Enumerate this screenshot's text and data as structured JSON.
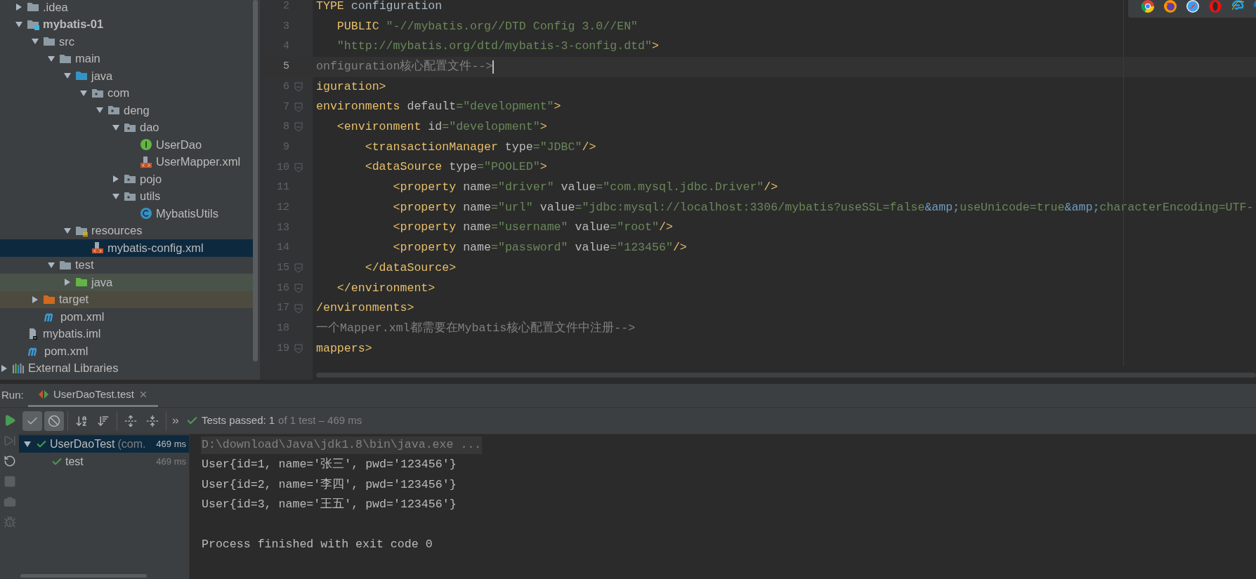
{
  "project_tree": {
    "items": [
      {
        "children": [
          {
            "label": ".idea",
            "kind": "folder",
            "expanded": false,
            "selected": false
          },
          {
            "label": "mybatis-01",
            "kind": "module",
            "expanded": true,
            "selected": false,
            "children": [
              {
                "label": "src",
                "kind": "folder",
                "expanded": true,
                "selected": false,
                "children": [
                  {
                    "label": "main",
                    "kind": "folder",
                    "expanded": true,
                    "selected": false,
                    "children": [
                      {
                        "label": "java",
                        "kind": "source-folder",
                        "expanded": true,
                        "selected": false,
                        "children": [
                          {
                            "label": "com",
                            "kind": "package",
                            "expanded": true,
                            "selected": false,
                            "children": [
                              {
                                "label": "deng",
                                "kind": "package",
                                "expanded": true,
                                "selected": false,
                                "children": [
                                  {
                                    "label": "dao",
                                    "kind": "package",
                                    "expanded": true,
                                    "selected": false,
                                    "children": [
                                      {
                                        "label": "UserDao",
                                        "kind": "interface",
                                        "selected": false
                                      },
                                      {
                                        "label": "UserMapper.xml",
                                        "kind": "xml",
                                        "selected": false
                                      }
                                    ]
                                  },
                                  {
                                    "label": "pojo",
                                    "kind": "package",
                                    "expanded": false,
                                    "selected": false
                                  },
                                  {
                                    "label": "utils",
                                    "kind": "package",
                                    "expanded": true,
                                    "selected": false,
                                    "children": [
                                      {
                                        "label": "MybatisUtils",
                                        "kind": "class",
                                        "selected": false
                                      }
                                    ]
                                  }
                                ]
                              }
                            ]
                          }
                        ]
                      },
                      {
                        "label": "resources",
                        "kind": "resources",
                        "expanded": true,
                        "selected": false,
                        "children": [
                          {
                            "label": "mybatis-config.xml",
                            "kind": "xml",
                            "selected": true
                          }
                        ]
                      }
                    ]
                  },
                  {
                    "label": "test",
                    "kind": "folder",
                    "expanded": true,
                    "selected": false,
                    "children": [
                      {
                        "label": "java",
                        "kind": "test-folder",
                        "expanded": false,
                        "selected": false
                      }
                    ]
                  }
                ]
              },
              {
                "label": "target",
                "kind": "excluded-folder",
                "expanded": false,
                "selected": false
              },
              {
                "label": "pom.xml",
                "kind": "maven",
                "selected": false
              }
            ]
          },
          {
            "label": "mybatis.iml",
            "kind": "iml",
            "selected": false
          },
          {
            "label": "pom.xml",
            "kind": "maven",
            "selected": false
          }
        ]
      },
      {
        "label": "External Libraries",
        "kind": "libraries",
        "expanded": false,
        "selected": false
      }
    ]
  },
  "editor": {
    "lines": [
      {
        "number": "2",
        "current": false,
        "fold": false,
        "tokens": [
          {
            "kind": "tag",
            "text": "TYPE"
          },
          {
            "kind": "plain",
            "text": " configuration"
          }
        ]
      },
      {
        "number": "3",
        "current": false,
        "fold": false,
        "tokens": [
          {
            "kind": "tag",
            "text": "   PUBLIC "
          },
          {
            "kind": "value",
            "text": "\"-//mybatis.org//DTD Config 3.0//EN\""
          }
        ]
      },
      {
        "number": "4",
        "current": false,
        "fold": false,
        "tokens": [
          {
            "kind": "value",
            "text": "   \"http://mybatis.org/dtd/mybatis-3-config.dtd\""
          },
          {
            "kind": "tag",
            "text": ">"
          }
        ]
      },
      {
        "number": "5",
        "current": true,
        "fold": false,
        "tokens": [
          {
            "kind": "comment",
            "text": "onfiguration核心配置文件-->"
          }
        ]
      },
      {
        "number": "6",
        "current": false,
        "fold": true,
        "tokens": [
          {
            "kind": "tag",
            "text": "iguration>"
          }
        ]
      },
      {
        "number": "7",
        "current": false,
        "fold": true,
        "tokens": [
          {
            "kind": "tag",
            "text": "environments"
          },
          {
            "kind": "attr",
            "text": " default"
          },
          {
            "kind": "value",
            "text": "=\"development\""
          },
          {
            "kind": "tag",
            "text": ">"
          }
        ]
      },
      {
        "number": "8",
        "current": false,
        "fold": true,
        "tokens": [
          {
            "kind": "tag",
            "text": "   <environment"
          },
          {
            "kind": "attr",
            "text": " id"
          },
          {
            "kind": "value",
            "text": "=\"development\""
          },
          {
            "kind": "tag",
            "text": ">"
          }
        ]
      },
      {
        "number": "9",
        "current": false,
        "fold": false,
        "tokens": [
          {
            "kind": "tag",
            "text": "       <transactionManager"
          },
          {
            "kind": "attr",
            "text": " type"
          },
          {
            "kind": "value",
            "text": "=\"JDBC\""
          },
          {
            "kind": "tag",
            "text": "/>"
          }
        ]
      },
      {
        "number": "10",
        "current": false,
        "fold": true,
        "tokens": [
          {
            "kind": "tag",
            "text": "       <dataSource"
          },
          {
            "kind": "attr",
            "text": " type"
          },
          {
            "kind": "value",
            "text": "=\"POOLED\""
          },
          {
            "kind": "tag",
            "text": ">"
          }
        ]
      },
      {
        "number": "11",
        "current": false,
        "fold": false,
        "tokens": [
          {
            "kind": "tag",
            "text": "           <property"
          },
          {
            "kind": "attr",
            "text": " name"
          },
          {
            "kind": "value",
            "text": "=\"driver\""
          },
          {
            "kind": "attr",
            "text": " value"
          },
          {
            "kind": "value",
            "text": "=\"com.mysql.jdbc.Driver\""
          },
          {
            "kind": "tag",
            "text": "/>"
          }
        ]
      },
      {
        "number": "12",
        "current": false,
        "fold": false,
        "tokens": [
          {
            "kind": "tag",
            "text": "           <property"
          },
          {
            "kind": "attr",
            "text": " name"
          },
          {
            "kind": "value",
            "text": "=\"url\""
          },
          {
            "kind": "attr",
            "text": " value"
          },
          {
            "kind": "value",
            "text": "=\"jdbc:mysql://localhost:3306/mybatis?useSSL=false"
          },
          {
            "kind": "entity",
            "text": "&amp;"
          },
          {
            "kind": "value",
            "text": "useUnicode=true"
          },
          {
            "kind": "entity",
            "text": "&amp;"
          },
          {
            "kind": "value",
            "text": "characterEncoding=UTF-"
          }
        ]
      },
      {
        "number": "13",
        "current": false,
        "fold": false,
        "tokens": [
          {
            "kind": "tag",
            "text": "           <property"
          },
          {
            "kind": "attr",
            "text": " name"
          },
          {
            "kind": "value",
            "text": "=\"username\""
          },
          {
            "kind": "attr",
            "text": " value"
          },
          {
            "kind": "value",
            "text": "=\"root\""
          },
          {
            "kind": "tag",
            "text": "/>"
          }
        ]
      },
      {
        "number": "14",
        "current": false,
        "fold": false,
        "tokens": [
          {
            "kind": "tag",
            "text": "           <property"
          },
          {
            "kind": "attr",
            "text": " name"
          },
          {
            "kind": "value",
            "text": "=\"password\""
          },
          {
            "kind": "attr",
            "text": " value"
          },
          {
            "kind": "value",
            "text": "=\"123456\""
          },
          {
            "kind": "tag",
            "text": "/>"
          }
        ]
      },
      {
        "number": "15",
        "current": false,
        "fold": true,
        "tokens": [
          {
            "kind": "tag",
            "text": "       </dataSource>"
          }
        ]
      },
      {
        "number": "16",
        "current": false,
        "fold": true,
        "tokens": [
          {
            "kind": "tag",
            "text": "   </environment>"
          }
        ]
      },
      {
        "number": "17",
        "current": false,
        "fold": true,
        "tokens": [
          {
            "kind": "tag",
            "text": "/environments>"
          }
        ]
      },
      {
        "number": "18",
        "current": false,
        "fold": false,
        "tokens": [
          {
            "kind": "comment",
            "text": "一个Mapper.xml都需要在Mybatis核心配置文件中注册-->"
          }
        ]
      },
      {
        "number": "19",
        "current": false,
        "fold": true,
        "tokens": [
          {
            "kind": "tag",
            "text": "mappers>"
          }
        ]
      }
    ]
  },
  "browser_icons": [
    {
      "kind": "chrome"
    },
    {
      "kind": "firefox"
    },
    {
      "kind": "safari"
    },
    {
      "kind": "opera"
    },
    {
      "kind": "ie"
    },
    {
      "kind": "edge"
    }
  ],
  "run_panel": {
    "label": "Run:",
    "tabs": [
      {
        "label": "UserDaoTest.test",
        "selected": true
      }
    ],
    "side_actions": [
      {
        "kind": "run",
        "disabled": false
      },
      {
        "kind": "rerun-failed",
        "disabled": true
      },
      {
        "kind": "auto-test",
        "disabled": false
      },
      {
        "kind": "stop",
        "disabled": true
      },
      {
        "kind": "screenshot",
        "disabled": true
      },
      {
        "kind": "settings",
        "disabled": true
      }
    ],
    "toolbar_groups": [
      [
        {
          "kind": "show-passed",
          "pressed": true
        },
        {
          "kind": "show-ignored",
          "pressed": true
        }
      ],
      [
        {
          "kind": "sort-alpha",
          "pressed": false
        },
        {
          "kind": "sort-duration",
          "pressed": false
        }
      ],
      [
        {
          "kind": "expand-all",
          "pressed": false
        },
        {
          "kind": "collapse-all",
          "pressed": false
        }
      ],
      [
        {
          "kind": "more",
          "pressed": false
        }
      ]
    ],
    "status": {
      "label": "Tests passed:",
      "count": "1",
      "detail": "of 1 test – 469 ms"
    },
    "tests": [
      {
        "name": "UserDaoTest",
        "location": "(com.",
        "time": "469 ms",
        "kind": "passed",
        "selected": true,
        "children": [
          {
            "name": "test",
            "time": "469 ms",
            "kind": "passed",
            "selected": false
          }
        ]
      }
    ],
    "console": [
      {
        "kind": "command",
        "text": "D:\\download\\Java\\jdk1.8\\bin\\java.exe ..."
      },
      {
        "kind": "output",
        "text": "User{id=1, name='张三', pwd='123456'}"
      },
      {
        "kind": "output",
        "text": "User{id=2, name='李四', pwd='123456'}"
      },
      {
        "kind": "output",
        "text": "User{id=3, name='王五', pwd='123456'}"
      },
      {
        "kind": "blank"
      },
      {
        "kind": "system",
        "text": "Process finished with exit code 0"
      }
    ]
  }
}
